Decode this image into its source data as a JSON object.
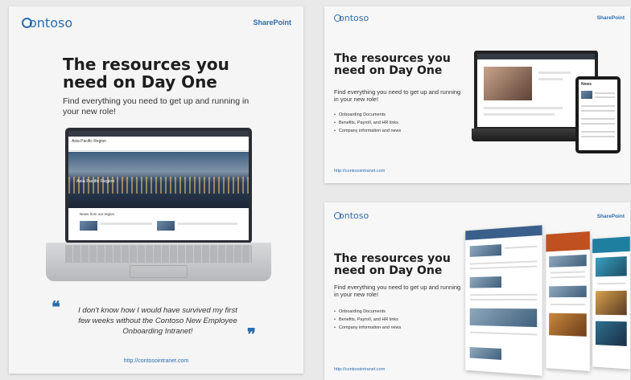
{
  "brand": {
    "logo_text": "ontoso",
    "product": "SharePoint",
    "accent": "#2a6db0"
  },
  "portrait": {
    "headline": "The resources you need on Day One",
    "subtitle": "Find everything you need to get up and running in your new role!",
    "quote": "I don't know how I would have survived my first few weeks without the Contoso New Employee Onboarding Intranet!",
    "url": "http://contosointranet.com",
    "screen": {
      "site_title": "Asia Pacific Region",
      "hero_label": "Asia Pacific Region",
      "news_title": "News from our region"
    }
  },
  "landscape_devices": {
    "headline": "The resources you need on Day One",
    "subtitle": "Find everything you need to get up and running in your new role!",
    "bullets": [
      "Onboarding Documents",
      "Benefits, Payroll, and HR links",
      "Company information and news"
    ],
    "url": "http://contosointranet.com",
    "phone_title": "News"
  },
  "landscape_pages": {
    "headline": "The resources you need on Day One",
    "subtitle": "Find everything you need to get up and running in your new role!",
    "bullets": [
      "Onboarding Documents",
      "Benefits, Payroll, and HR links",
      "Company information and news"
    ],
    "url": "http://contosointranet.com"
  }
}
